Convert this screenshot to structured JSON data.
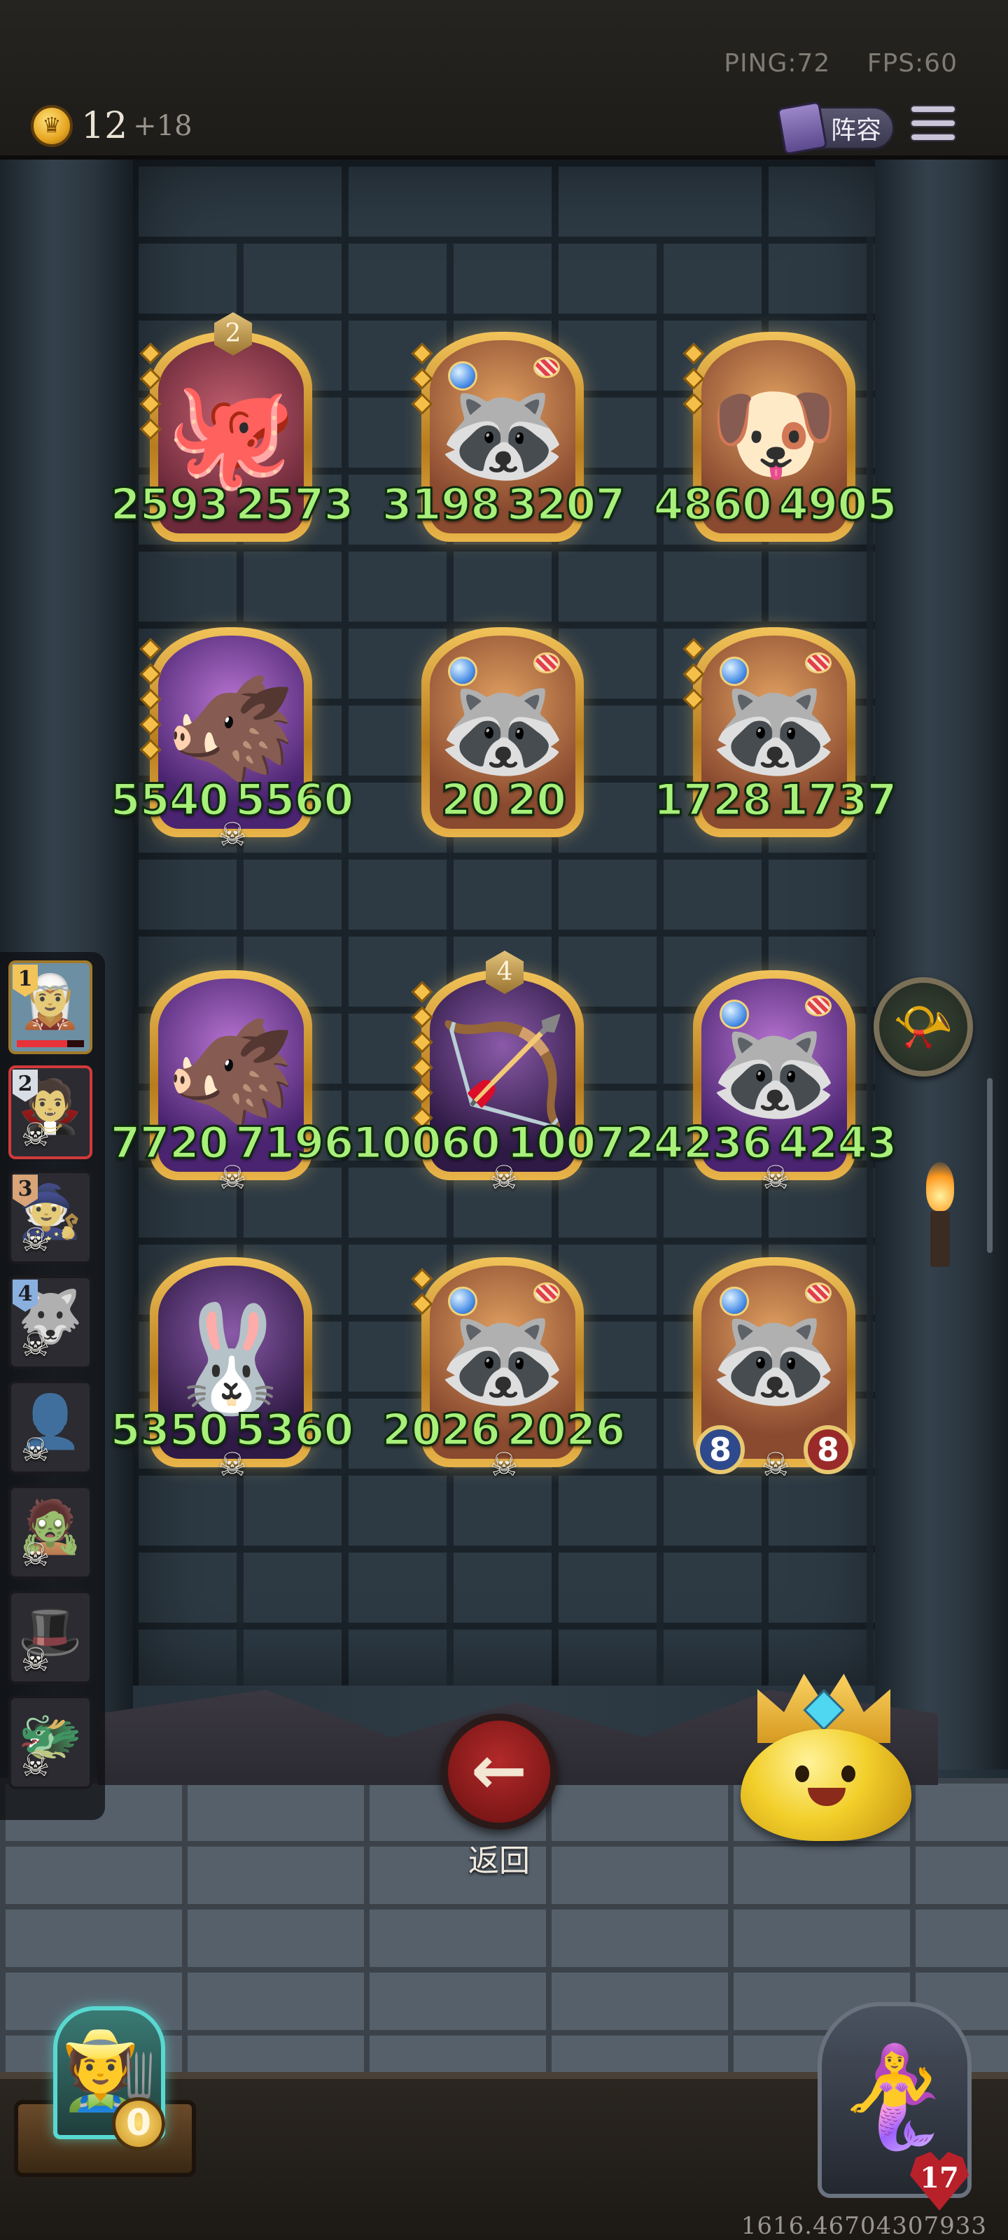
{
  "hud": {
    "ping": "PING:72",
    "fps": "FPS:60",
    "coins": "12",
    "coin_bonus": "+18",
    "lineup_label": "阵容"
  },
  "board": {
    "cards": [
      {
        "hero": "octopus",
        "glyph": "🐙",
        "bg": "red",
        "stars": 4,
        "level_badge": "2",
        "left": "2593",
        "right": "2573"
      },
      {
        "hero": "raccoon",
        "glyph": "🦝",
        "bg": "orange",
        "stars": 3,
        "level_badge": "",
        "gems": true,
        "left": "3198",
        "right": "3207"
      },
      {
        "hero": "dog",
        "glyph": "🐶",
        "bg": "orange",
        "stars": 3,
        "level_badge": "",
        "left": "4860",
        "right": "4905"
      },
      {
        "hero": "boar",
        "glyph": "🐗",
        "bg": "purple",
        "stars": 5,
        "level_badge": "",
        "skull": true,
        "left": "5540",
        "right": "5560"
      },
      {
        "hero": "raccoon",
        "glyph": "🦝",
        "bg": "orange",
        "stars": 0,
        "level_badge": "",
        "gems": true,
        "left": "20",
        "right": "20"
      },
      {
        "hero": "raccoon",
        "glyph": "🦝",
        "bg": "orange",
        "stars": 3,
        "level_badge": "",
        "gems": true,
        "left": "1728",
        "right": "1737"
      },
      {
        "hero": "boar",
        "glyph": "🐗",
        "bg": "purple",
        "stars": 0,
        "level_badge": "",
        "skull": true,
        "left": "7720",
        "right": "7196"
      },
      {
        "hero": "archer",
        "glyph": "🏹",
        "bg": "dark",
        "stars": 6,
        "level_badge": "4",
        "skull": true,
        "left": "10060",
        "right": "10072"
      },
      {
        "hero": "raccoon",
        "glyph": "🦝",
        "bg": "purple",
        "stars": 0,
        "level_badge": "",
        "gems": true,
        "skull": true,
        "left": "4236",
        "right": "4243"
      },
      {
        "hero": "rabbit-mask",
        "glyph": "🐰",
        "bg": "dark",
        "stars": 0,
        "level_badge": "",
        "skull": true,
        "left": "5350",
        "right": "5360"
      },
      {
        "hero": "raccoon",
        "glyph": "🦝",
        "bg": "orange",
        "stars": 2,
        "level_badge": "",
        "gems": true,
        "skull": true,
        "left": "2026",
        "right": "2026"
      },
      {
        "hero": "raccoon",
        "glyph": "🦝",
        "bg": "orange",
        "stars": 0,
        "level_badge": "",
        "gems": true,
        "skull": true,
        "circles": true,
        "left": "8",
        "right": "8"
      }
    ]
  },
  "roster": {
    "players": [
      {
        "rank": "1",
        "rank_color": "gold",
        "glyph": "🧝",
        "active": true,
        "hp": 0.75
      },
      {
        "rank": "2",
        "rank_color": "silver",
        "glyph": "🧛",
        "selected": true,
        "dead": true
      },
      {
        "rank": "3",
        "rank_color": "bronze",
        "glyph": "🧙",
        "dead": true
      },
      {
        "rank": "4",
        "rank_color": "blue",
        "glyph": "🐺",
        "dead": true
      },
      {
        "rank": "",
        "glyph": "👤",
        "dead": true
      },
      {
        "rank": "",
        "glyph": "🧟",
        "dead": true
      },
      {
        "rank": "",
        "glyph": "🎩",
        "dead": true
      },
      {
        "rank": "",
        "glyph": "🐲",
        "dead": true
      }
    ]
  },
  "controls": {
    "back_label": "返回",
    "back_icon": "←"
  },
  "bottom": {
    "player_gold": "0",
    "player_hp": "17",
    "coordinate_readout": "1616.46704307933"
  },
  "icons": {
    "coin": "crown-coin-icon",
    "menu": "hamburger-menu-icon",
    "lineup": "book-icon",
    "item": "horn-icon",
    "skull": "skull-icon"
  },
  "colors": {
    "stat_text": "#a8f07a",
    "back_button": "#b32a2a",
    "card_frame": "#f2c35a"
  }
}
